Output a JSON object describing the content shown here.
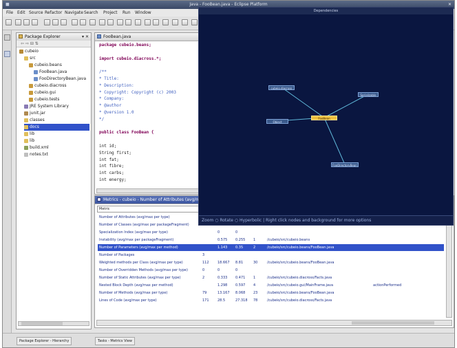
{
  "window": {
    "title": "Java - FooBean.java - Eclipse Platform"
  },
  "menu": [
    "File",
    "Edit",
    "Source",
    "Refactor",
    "Navigate",
    "Search",
    "Project",
    "Run",
    "Window"
  ],
  "package_explorer": {
    "tab_label": "Package Explorer",
    "items": [
      {
        "label": "cubeio",
        "depth": 0,
        "icon": "project-icon"
      },
      {
        "label": "src",
        "depth": 1,
        "icon": "folder-icon"
      },
      {
        "label": "cubeio.beans",
        "depth": 2,
        "icon": "package-icon"
      },
      {
        "label": "FooBean.java",
        "depth": 3,
        "icon": "java-file-icon"
      },
      {
        "label": "FooDirectoryBean.java",
        "depth": 3,
        "icon": "java-file-icon"
      },
      {
        "label": "cubeio.diacross",
        "depth": 2,
        "icon": "package-icon"
      },
      {
        "label": "cubeio.gui",
        "depth": 2,
        "icon": "package-icon"
      },
      {
        "label": "cubeio.tests",
        "depth": 2,
        "icon": "package-icon"
      },
      {
        "label": "JRE System Library",
        "depth": 1,
        "icon": "library-icon"
      },
      {
        "label": "junit.jar",
        "depth": 1,
        "icon": "jar-icon"
      },
      {
        "label": "classes",
        "depth": 1,
        "icon": "folder-icon"
      },
      {
        "label": "docs",
        "depth": 1,
        "icon": "folder-icon",
        "selected": true
      },
      {
        "label": "lib",
        "depth": 1,
        "icon": "folder-icon"
      },
      {
        "label": "lib",
        "depth": 1,
        "icon": "folder-icon"
      },
      {
        "label": "build.xml",
        "depth": 1,
        "icon": "xml-file-icon"
      },
      {
        "label": "notes.txt",
        "depth": 1,
        "icon": "text-file-icon"
      }
    ]
  },
  "editor": {
    "tab_label": "FooBean.java",
    "lines": [
      {
        "text": "package cubeio.beans;",
        "kind": "kw"
      },
      {
        "text": "",
        "kind": "plain"
      },
      {
        "text": "import cubeio.diacross.*;",
        "kind": "kw"
      },
      {
        "text": "",
        "kind": "plain"
      },
      {
        "text": "/**",
        "kind": "cm"
      },
      {
        "text": " * Title:",
        "kind": "cm"
      },
      {
        "text": " * Description:",
        "kind": "cm"
      },
      {
        "text": " * Copyright:    Copyright (c) 2003",
        "kind": "cm"
      },
      {
        "text": " * Company:",
        "kind": "cm"
      },
      {
        "text": " * @author",
        "kind": "cm"
      },
      {
        "text": " * @version 1.0",
        "kind": "cm"
      },
      {
        "text": " */",
        "kind": "cm"
      },
      {
        "text": "",
        "kind": "plain"
      },
      {
        "text": "public class FooBean {",
        "kind": "kw"
      },
      {
        "text": "",
        "kind": "plain"
      },
      {
        "text": "    int id;",
        "kind": "plain"
      },
      {
        "text": "    String first;",
        "kind": "plain"
      },
      {
        "text": "    int fat;",
        "kind": "plain"
      },
      {
        "text": "    int fibre;",
        "kind": "plain"
      },
      {
        "text": "    int carbs;",
        "kind": "plain"
      },
      {
        "text": "    int energy;",
        "kind": "plain"
      }
    ]
  },
  "graph_view": {
    "title": "Dependencies",
    "hint": "Zoom  ○ Rotate  ○ Hyperbolic  |  Right click nodes and background for more options",
    "nodes": [
      {
        "id": "center",
        "label": "FooBean",
        "center": true
      },
      {
        "id": "n1",
        "label": "cubeio.diacross"
      },
      {
        "id": "n2",
        "label": "Serializable"
      },
      {
        "id": "n3",
        "label": "Object"
      },
      {
        "id": "n4",
        "label": "FooDirectoryBean"
      }
    ]
  },
  "metrics": {
    "tab_label": "Metrics - cubeio - Number of Attributes (avg/max per type)",
    "filter_label": "Metric",
    "rows": [
      {
        "metric": "Number of Attributes (avg/max per type)",
        "total": "",
        "mean": "",
        "dev": "",
        "max": "",
        "resource": "",
        "method": ""
      },
      {
        "metric": "Number of Classes (avg/max per packageFragment)",
        "total": "",
        "mean": "",
        "dev": "",
        "max": "",
        "resource": "",
        "method": ""
      },
      {
        "metric": "Specialization Index (avg/max per type)",
        "total": "",
        "mean": "0",
        "dev": "0",
        "max": "",
        "resource": "",
        "method": ""
      },
      {
        "metric": "Instability (avg/max per packageFragment)",
        "total": "",
        "mean": "0.575",
        "dev": "0.255",
        "max": "1",
        "resource": "/cubeio/src/cubeio.beans",
        "method": ""
      },
      {
        "metric": "Number of Parameters (avg/max per method)",
        "total": "",
        "mean": "1.143",
        "dev": "0.35",
        "max": "2",
        "resource": "/cubeio/src/cubeio.beans/FooBean.java",
        "method": "",
        "selected": true
      },
      {
        "metric": "Number of Packages",
        "total": "3",
        "mean": "",
        "dev": "",
        "max": "",
        "resource": "",
        "method": ""
      },
      {
        "metric": "Weighted methods per Class (avg/max per type)",
        "total": "112",
        "mean": "18.667",
        "dev": "8.81",
        "max": "30",
        "resource": "/cubeio/src/cubeio.beans/FooBean.java",
        "method": ""
      },
      {
        "metric": "Number of Overridden Methods (avg/max per type)",
        "total": "0",
        "mean": "0",
        "dev": "0",
        "max": "",
        "resource": "",
        "method": ""
      },
      {
        "metric": "Number of Static Attributes (avg/max per type)",
        "total": "2",
        "mean": "0.333",
        "dev": "0.471",
        "max": "1",
        "resource": "/cubeio/src/cubeio.diacross/Facts.java",
        "method": ""
      },
      {
        "metric": "Nested Block Depth (avg/max per method)",
        "total": "",
        "mean": "1.298",
        "dev": "0.597",
        "max": "4",
        "resource": "/cubeio/src/cubeio.gui/MainFrame.java",
        "method": "actionPerformed"
      },
      {
        "metric": "Number of Methods (avg/max per type)",
        "total": "79",
        "mean": "13.167",
        "dev": "8.068",
        "max": "23",
        "resource": "/cubeio/src/cubeio.beans/FooBean.java",
        "method": ""
      },
      {
        "metric": "Lines of Code (avg/max per type)",
        "total": "171",
        "mean": "28.5",
        "dev": "27.318",
        "max": "78",
        "resource": "/cubeio/src/cubeio.diacross/Facts.java",
        "method": ""
      }
    ]
  },
  "status": {
    "left": "Package Explorer - Hierarchy",
    "right": "Tasks - Metrics View"
  },
  "colors": {
    "graph_bg": "#0a1640",
    "graph_edge": "#5fb7d8",
    "selection": "#3152c9",
    "center_node": "#f0c040"
  }
}
